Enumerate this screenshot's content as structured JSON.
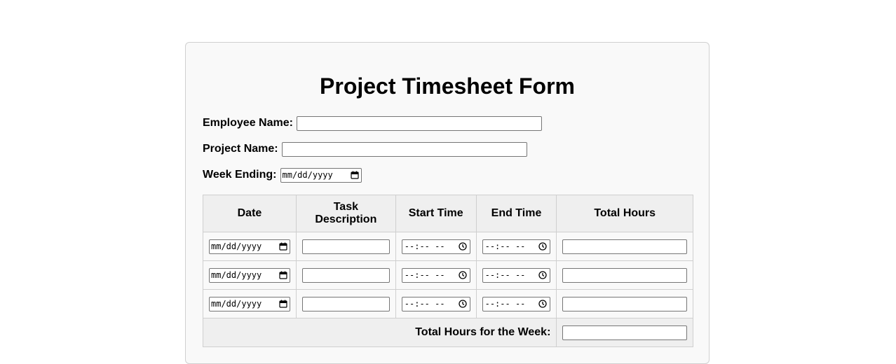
{
  "form": {
    "title": "Project Timesheet Form",
    "employee_name_label": "Employee Name:",
    "employee_name_value": "",
    "project_name_label": "Project Name:",
    "project_name_value": "",
    "week_ending_label": "Week Ending:",
    "week_ending_placeholder": "mm/dd/yyyy"
  },
  "table": {
    "headers": {
      "date": "Date",
      "task_line1": "Task",
      "task_line2": "Description",
      "start": "Start Time",
      "end": "End Time",
      "total": "Total Hours"
    },
    "rows": [
      {
        "date": "mm/dd/yyyy",
        "task": "",
        "start": "--:-- --",
        "end": "--:-- --",
        "total": ""
      },
      {
        "date": "mm/dd/yyyy",
        "task": "",
        "start": "--:-- --",
        "end": "--:-- --",
        "total": ""
      },
      {
        "date": "mm/dd/yyyy",
        "task": "",
        "start": "--:-- --",
        "end": "--:-- --",
        "total": ""
      }
    ],
    "footer_label": "Total Hours for the Week:",
    "footer_value": ""
  },
  "icons": {
    "date_picker": "calendar-icon",
    "time_picker": "clock-icon"
  }
}
